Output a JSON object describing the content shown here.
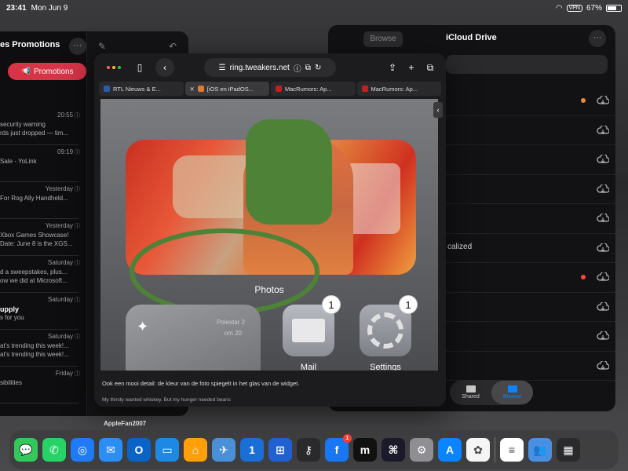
{
  "status_bar": {
    "time": "23:41",
    "date": "Mon Jun 9",
    "vpn": "VPN",
    "battery": "67%",
    "battery_level": 0.67
  },
  "mail": {
    "header_title": "es Promotions",
    "more_label": "···",
    "promotions_button": "Promotions",
    "messages": [
      {
        "time": "20:55",
        "line1": "security warning",
        "line2": "rds just dropped — tim...",
        "bold": false
      },
      {
        "time": "09:19",
        "line1": "Sale - YoLink",
        "line2": "",
        "bold": false
      },
      {
        "time": "Yesterday",
        "line1": "For Rog Ally Handheld...",
        "line2": "",
        "bold": false
      },
      {
        "time": "Yesterday",
        "line1": "Xbox Games Showcase!",
        "line2": "Date: June 8 is the XGS...",
        "bold": false
      },
      {
        "time": "Saturday",
        "line1": "d a sweepstakes, plus...",
        "line2": "ow we did at Microsoft...",
        "bold": false
      },
      {
        "time": "Saturday",
        "line1": "upply",
        "line2": "s for you",
        "bold": true
      },
      {
        "time": "Saturday",
        "line1": "at's trending this week!...",
        "line2": "at's trending this week!...",
        "bold": false
      },
      {
        "time": "Friday",
        "line1": "sibilities",
        "line2": "",
        "bold": false
      }
    ]
  },
  "icloud": {
    "title": "iCloud Drive",
    "browse_button": "Browse",
    "more_label": "···",
    "localized_label": "calized",
    "tabs": {
      "shared": "Shared",
      "browse": "Browse"
    },
    "row_dots": [
      "#f0883a",
      "",
      "",
      "",
      "",
      "",
      "#ff453a",
      "",
      "",
      ""
    ]
  },
  "safari": {
    "url": "ring.tweakers.net",
    "tabs": [
      {
        "label": "RTL Nieuws & E...",
        "color": "#2a5caa",
        "active": false
      },
      {
        "label": "[iOS en iPadOS...",
        "color": "#e07a30",
        "active": true
      },
      {
        "label": "MacRumors: Ap...",
        "color": "#c02020",
        "active": false
      },
      {
        "label": "MacRumors: Ap...",
        "color": "#c02020",
        "active": false
      }
    ],
    "widget": {
      "photos_label": "Photos",
      "polestar_label": "Polestar 2",
      "polestar_sub": "om 20",
      "mail_app": "Mail",
      "settings_app": "Settings",
      "mail_badge": "1",
      "settings_badge": "1"
    },
    "caption": "Ook een mooi detail: de kleur van de foto spiegelt in het glas van de widget.",
    "signature": "My thirsty wanted whiskey. But my hunger needed beans",
    "next_author": "AppleFan2007"
  },
  "dock": {
    "apps": [
      {
        "name": "messages-icon",
        "color": "#34c759",
        "glyph": "💬",
        "badge": ""
      },
      {
        "name": "whatsapp-icon",
        "color": "#25d366",
        "glyph": "✆",
        "badge": ""
      },
      {
        "name": "safari-icon",
        "color": "#1e7bf5",
        "glyph": "◎",
        "badge": ""
      },
      {
        "name": "mail-icon",
        "color": "#2a8ef5",
        "glyph": "✉",
        "badge": ""
      },
      {
        "name": "outlook-icon",
        "color": "#0a64c8",
        "glyph": "O",
        "badge": ""
      },
      {
        "name": "files-icon",
        "color": "#1e88e5",
        "glyph": "▭",
        "badge": ""
      },
      {
        "name": "home-icon",
        "color": "#ff9f0a",
        "glyph": "⌂",
        "badge": ""
      },
      {
        "name": "testflight-icon",
        "color": "#4a90d9",
        "glyph": "✈",
        "badge": ""
      },
      {
        "name": "1password-icon",
        "color": "#1a6ed8",
        "glyph": "1",
        "badge": ""
      },
      {
        "name": "windows-app-icon",
        "color": "#2060d0",
        "glyph": "⊞",
        "badge": ""
      },
      {
        "name": "keys-icon",
        "color": "#2a2a2c",
        "glyph": "⚷",
        "badge": ""
      },
      {
        "name": "facebook-icon",
        "color": "#1877f2",
        "glyph": "f",
        "badge": "1"
      },
      {
        "name": "mastodon-icon",
        "color": "#111111",
        "glyph": "m",
        "badge": ""
      },
      {
        "name": "touchid-icon",
        "color": "#1a1a2a",
        "glyph": "⌘",
        "badge": ""
      },
      {
        "name": "settings-icon",
        "color": "#8e8e93",
        "glyph": "⚙",
        "badge": ""
      },
      {
        "name": "appstore-icon",
        "color": "#0a84ff",
        "glyph": "A",
        "badge": ""
      },
      {
        "name": "photos-icon",
        "color": "#f5f5f5",
        "glyph": "✿",
        "badge": ""
      }
    ],
    "recents": [
      {
        "name": "document-icon",
        "color": "#ffffff",
        "glyph": "≡"
      },
      {
        "name": "shared-folder-icon",
        "color": "#4a90e2",
        "glyph": "👥"
      },
      {
        "name": "app-library-icon",
        "color": "#2a2a2c",
        "glyph": "▦"
      }
    ]
  }
}
